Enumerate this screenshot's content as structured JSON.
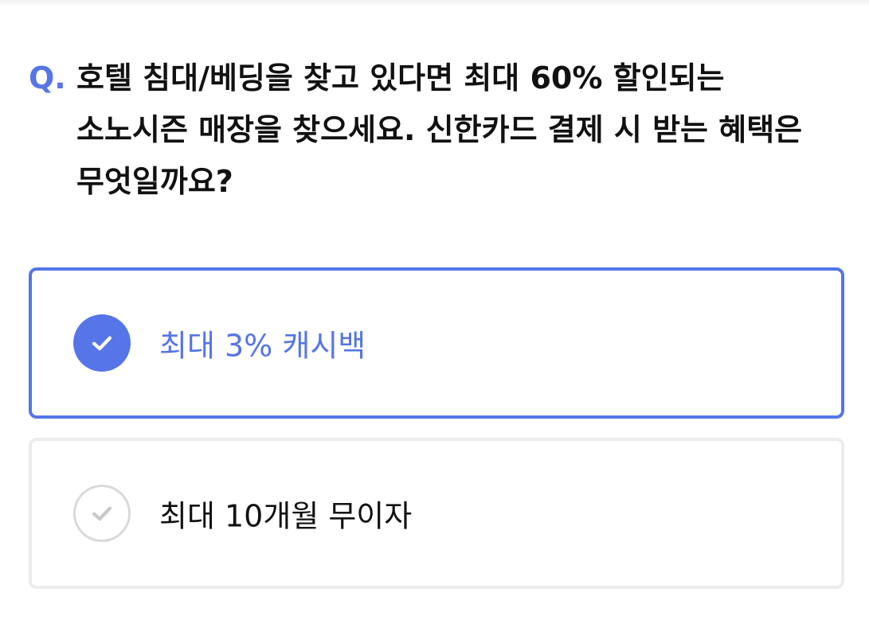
{
  "question": {
    "prefix": "Q.",
    "text": "호텔 침대/베딩을 찾고 있다면 최대 60% 할인되는 소노시즌 매장을 찾으세요. 신한카드 결제 시 받는 혜택은 무엇일까요?"
  },
  "options": [
    {
      "label": "최대 3% 캐시백",
      "selected": true,
      "icon": "check-circle-filled-icon"
    },
    {
      "label": "최대 10개월 무이자",
      "selected": false,
      "icon": "check-circle-outline-icon"
    }
  ],
  "colors": {
    "accent": "#5575e8",
    "text": "#111111",
    "border_unselected": "#ececec",
    "check_outline": "#d9d9d9"
  }
}
